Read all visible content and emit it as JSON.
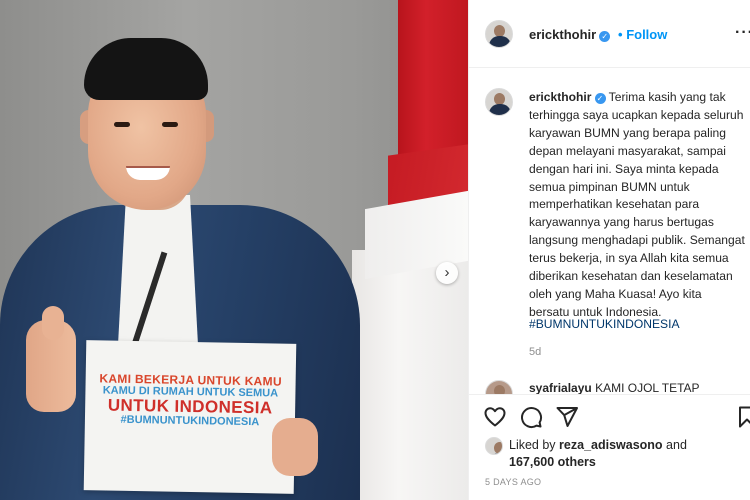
{
  "post": {
    "username": "erickthohir",
    "follow_label": "Follow",
    "dot": "•",
    "more": "···",
    "image": {
      "sign_line1": "KAMI BEKERJA UNTUK KAMU",
      "sign_line2": "KAMU DI RUMAH UNTUK SEMUA",
      "sign_line3": "UNTUK INDONESIA",
      "sign_line4": "#BUMNUNTUKINDONESIA",
      "next_arrow": "›"
    },
    "caption": {
      "username": "erickthohir",
      "text": "Terima kasih yang tak terhingga saya ucapkan kepada seluruh karyawan BUMN yang berapa paling depan melayani masyarakat, sampai dengan hari ini. Saya minta kepada semua pimpinan BUMN untuk memperhatikan kesehatan para karyawannya yang harus bertugas langsung menghadapi publik. Semangat terus bekerja, in sya Allah kita semua diberikan kesehatan dan keselamatan oleh yang Maha Kuasa! Ayo kita bersatu untuk Indonesia.",
      "hashtag": "#BUMNUNTUKINDONESIA",
      "age": "5d"
    },
    "comment": {
      "username": "syafrialayu",
      "text": "KAMI OJOL TETAP"
    },
    "likes": {
      "prefix": "Liked by",
      "liker": "reza_adiswasono",
      "conjunction": "and",
      "others": "167,600 others"
    },
    "time_ago": "5 DAYS AGO"
  }
}
